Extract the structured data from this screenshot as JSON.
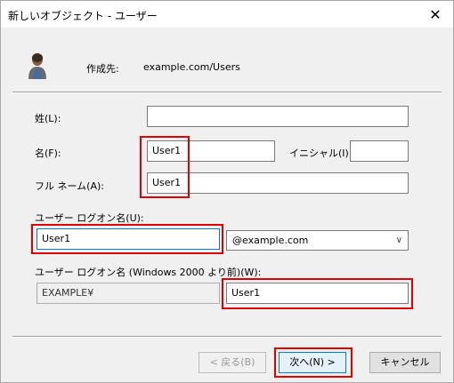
{
  "window": {
    "title": "新しいオブジェクト - ユーザー",
    "close_glyph": "✕"
  },
  "header": {
    "create_in_label": "作成先:",
    "create_in_value": "example.com/Users",
    "icon": "user-icon"
  },
  "fields": {
    "last_name": {
      "label": "姓(L):",
      "value": ""
    },
    "first_name": {
      "label": "名(F):",
      "value": "User1"
    },
    "initials": {
      "label": "イニシャル(I):",
      "value": ""
    },
    "full_name": {
      "label": "フル ネーム(A):",
      "value": "User1"
    },
    "logon_name": {
      "label": "ユーザー ログオン名(U):",
      "value": "User1"
    },
    "upn_suffix": {
      "value": "@example.com",
      "chevron": "∨"
    },
    "logon_name_pre2000": {
      "label": "ユーザー ログオン名 (Windows 2000 より前)(W):",
      "domain_prefix": "EXAMPLE¥",
      "value": "User1"
    }
  },
  "buttons": {
    "back": "< 戻る(B)",
    "next": "次へ(N) >",
    "cancel": "キャンセル"
  },
  "colors": {
    "highlight": "#e00000",
    "accent": "#0078d7"
  }
}
